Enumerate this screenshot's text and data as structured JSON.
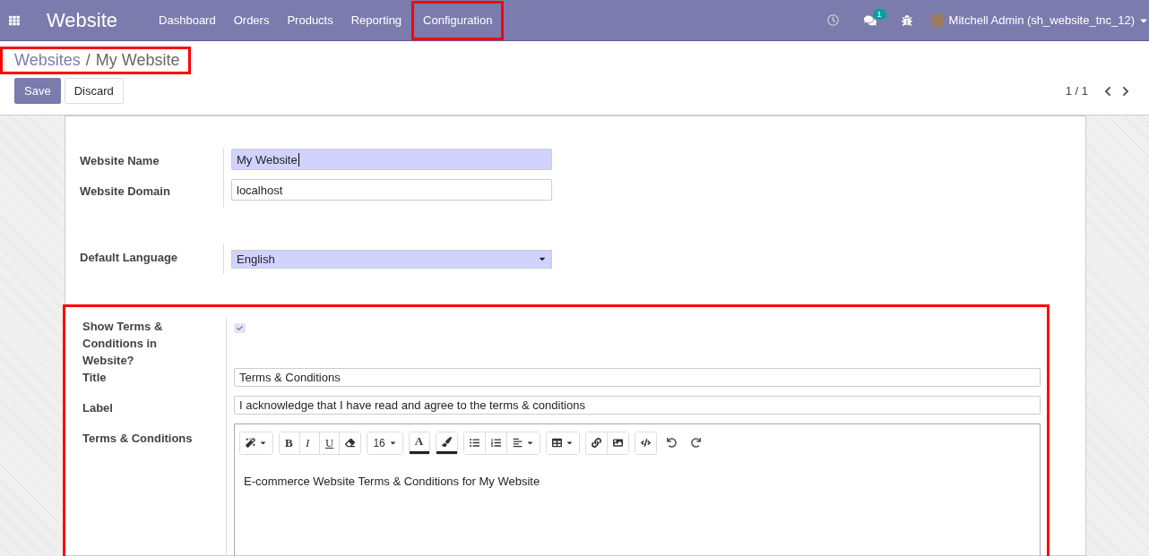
{
  "navbar": {
    "app_title": "Website",
    "menu": [
      {
        "label": "Dashboard",
        "highlighted": false
      },
      {
        "label": "Orders",
        "highlighted": false
      },
      {
        "label": "Products",
        "highlighted": false
      },
      {
        "label": "Reporting",
        "highlighted": false
      },
      {
        "label": "Configuration",
        "highlighted": true
      }
    ],
    "messages_badge": "1",
    "user": "Mitchell Admin (sh_website_tnc_12)"
  },
  "breadcrumb": {
    "parent": "Websites",
    "separator": "/",
    "current": "My Website",
    "highlighted": true
  },
  "buttons": {
    "save": "Save",
    "discard": "Discard"
  },
  "pager": "1 / 1",
  "form": {
    "name_label": "Website Name",
    "name_value": "My Website",
    "domain_label": "Website Domain",
    "domain_value": "localhost",
    "language_label": "Default Language",
    "language_value": "English",
    "terms_section": {
      "highlighted": true,
      "show_label": "Show Terms & Conditions in Website?",
      "show_checked": true,
      "title_label": "Title",
      "title_value": "Terms & Conditions",
      "label_label": "Label",
      "label_value": "I acknowledge that I have read and agree to the terms & conditions",
      "terms_label": "Terms & Conditions",
      "toolbar": [
        {
          "items": [
            {
              "kind": "wand",
              "dropdown": true
            }
          ]
        },
        {
          "items": [
            {
              "kind": "bold",
              "label": "B"
            },
            {
              "kind": "italic",
              "label": "I"
            },
            {
              "kind": "underline",
              "label": "U"
            },
            {
              "kind": "eraser"
            }
          ]
        },
        {
          "items": [
            {
              "kind": "size",
              "label": "16",
              "dropdown": true
            }
          ]
        },
        {
          "items": [
            {
              "kind": "fontcolor",
              "label": "A"
            }
          ]
        },
        {
          "items": [
            {
              "kind": "brush"
            }
          ]
        },
        {
          "items": [
            {
              "kind": "ul"
            },
            {
              "kind": "ol"
            },
            {
              "kind": "align",
              "dropdown": true
            }
          ]
        },
        {
          "items": [
            {
              "kind": "table",
              "dropdown": true
            }
          ]
        },
        {
          "items": [
            {
              "kind": "link"
            },
            {
              "kind": "image"
            }
          ]
        },
        {
          "items": [
            {
              "kind": "code"
            }
          ]
        },
        {
          "items": [
            {
              "kind": "undo"
            },
            {
              "kind": "redo"
            }
          ]
        }
      ],
      "content": "E-commerce Website Terms & Conditions for My Website"
    }
  }
}
